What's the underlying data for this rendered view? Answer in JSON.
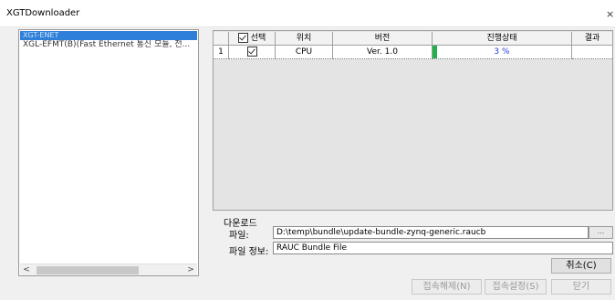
{
  "window": {
    "title": "XGTDownloader",
    "close_glyph": "×"
  },
  "tree": {
    "items": [
      {
        "label": "XGT-ENET",
        "selected": true
      },
      {
        "label": "XGL-EFMT(B)(Fast Ethernet 통신 모듈, 전...",
        "selected": false
      }
    ],
    "scroll_left": "<",
    "scroll_right": ">"
  },
  "grid": {
    "headers": {
      "row_num": "",
      "select": "선택",
      "location": "위치",
      "version": "버전",
      "progress": "진행상태",
      "result": "결과"
    },
    "rows": [
      {
        "num": "1",
        "checked": true,
        "location": "CPU",
        "version": "Ver. 1.0",
        "progress_text": "3 %",
        "progress": 0.03,
        "result": ""
      }
    ]
  },
  "download": {
    "section_label": "다운로드",
    "file_label": "파일:",
    "file_path": "D:\\temp\\bundle\\update-bundle-zynq-generic.raucb",
    "browse_label": "...",
    "fileinfo_label": "파일 정보:",
    "fileinfo_value": "RAUC Bundle File"
  },
  "buttons": {
    "cancel": "취소(C)",
    "disconnect": "접속해제(N)",
    "connect_settings": "접속설정(S)",
    "close": "닫기"
  },
  "colors": {
    "selection": "#2d7fd8",
    "progress_fill": "#22b14c",
    "progress_text": "#1f3bd8"
  }
}
